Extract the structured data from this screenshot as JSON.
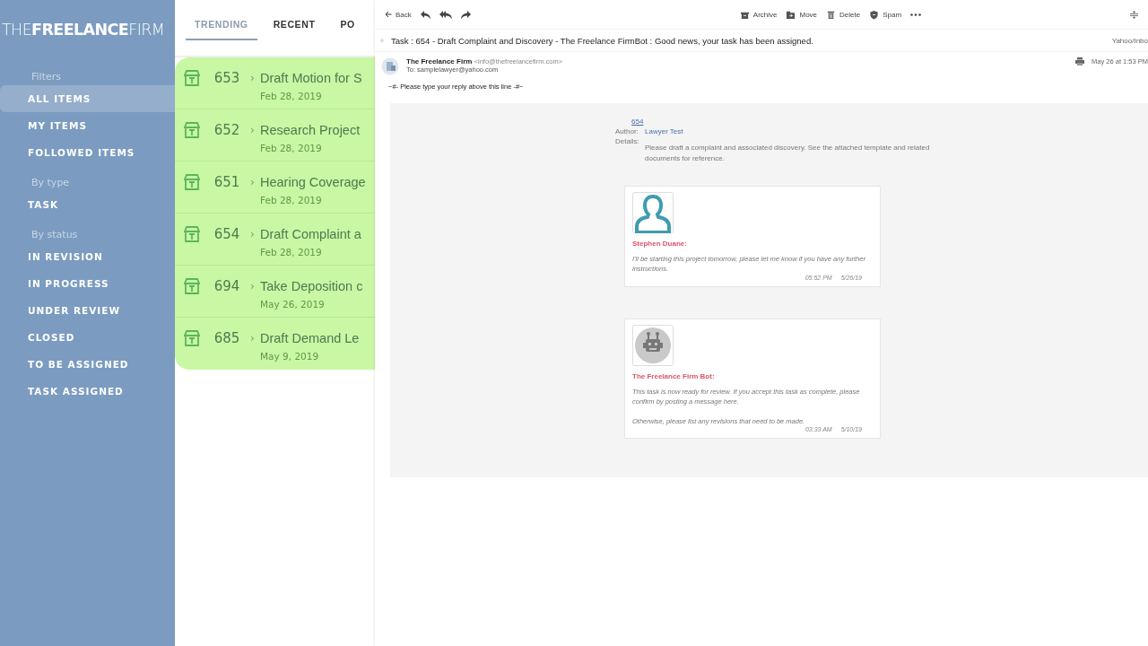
{
  "sidebar": {
    "logo": "THE**FREELANCE**FIRM",
    "sections": [
      {
        "heading": "Filters",
        "items": [
          {
            "label": "ALL ITEMS",
            "selected": true
          },
          {
            "label": "MY ITEMS",
            "selected": false
          },
          {
            "label": "FOLLOWED ITEMS",
            "selected": false
          }
        ]
      },
      {
        "heading": "By type",
        "items": [
          {
            "label": "TASK",
            "selected": false
          }
        ]
      },
      {
        "heading": "By status",
        "items": [
          {
            "label": "IN REVISION",
            "selected": false
          },
          {
            "label": "IN PROGRESS",
            "selected": false
          },
          {
            "label": "UNDER REVIEW",
            "selected": false
          },
          {
            "label": "CLOSED",
            "selected": false
          },
          {
            "label": "TO BE ASSIGNED",
            "selected": false
          },
          {
            "label": "TASK ASSIGNED",
            "selected": false
          }
        ]
      }
    ]
  },
  "tabs": [
    {
      "label": "TRENDING",
      "selected": true
    },
    {
      "label": "RECENT",
      "selected": false
    },
    {
      "label": "PO",
      "selected": false
    }
  ],
  "tasks": [
    {
      "number": "653",
      "chevron": "›",
      "title": "Draft Motion for S",
      "date": "Feb 28, 2019"
    },
    {
      "number": "652",
      "chevron": "›",
      "title": "Research Project",
      "date": "Feb 28, 2019"
    },
    {
      "number": "651",
      "chevron": "›",
      "title": "Hearing Coverage",
      "date": "Feb 28, 2019"
    },
    {
      "number": "654",
      "chevron": "›",
      "title": "Draft Complaint a",
      "date": "Feb 28, 2019"
    },
    {
      "number": "694",
      "chevron": "›",
      "title": "Take Deposition c",
      "date": "May 26, 2019"
    },
    {
      "number": "685",
      "chevron": "›",
      "title": "Draft Demand Le",
      "date": "May 9, 2019"
    }
  ],
  "email": {
    "toolbar": {
      "back": "Back",
      "actions": [
        {
          "kind": "archive",
          "label": "Archive"
        },
        {
          "kind": "move",
          "label": "Move"
        },
        {
          "kind": "delete",
          "label": "Delete"
        },
        {
          "kind": "spam",
          "label": "Spam"
        }
      ]
    },
    "subject": "Task : 654 - Draft Complaint and Discovery - The Freelance FirmBot : Good news, your task has been assigned.",
    "folder": "Yahoo/Inbo",
    "sender": "The Freelance Firm",
    "sender_address": "<info@thefreelancefirm.com>",
    "to": "To: samplelawyer@yahoo.com",
    "date": "May 26 at 1:53 PM",
    "reply_line": "~#- Please type your reply above this line -#~",
    "task": {
      "link": "654",
      "author_label": "Author:",
      "author": "Lawyer Test",
      "details_label": "Details:",
      "details": "Please draft a complaint and associated discovery. See the attached template and related documents for reference."
    },
    "comments": [
      {
        "kind": "person",
        "name": "Stephen Duane:",
        "paragraphs": [
          "I'll be starting this project tomorrow, please let me know if you have any further instructions."
        ],
        "time": "05:52 PM",
        "date": "5/26/19"
      },
      {
        "kind": "bot",
        "name": "The Freelance Firm Bot:",
        "paragraphs": [
          "This task is now ready for review.  If you accept this task as complete, please confirm by posting a message here.",
          "Otherwise, please list any revisions that need to be made."
        ],
        "time": "03:33 AM",
        "date": "5/10/19"
      }
    ]
  }
}
